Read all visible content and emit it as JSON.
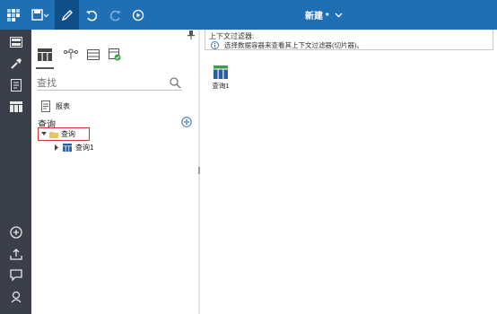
{
  "header": {
    "document_title": "新建 *",
    "colors": {
      "bar": "#1f6fb5",
      "active_tool": "#0f4e87"
    }
  },
  "rail": {
    "items": [
      "view-icon",
      "tools-icon",
      "document-icon",
      "table-icon",
      "add-icon",
      "upload-icon",
      "comment-icon",
      "user-icon"
    ]
  },
  "panel": {
    "tabs": [
      "data-grid-icon",
      "hierarchy-icon",
      "layout-icon",
      "checklist-icon"
    ],
    "search_placeholder": "查找",
    "report_label": "报表",
    "queries_label": "查询",
    "tree": {
      "folder_label": "查询",
      "query_label": "查询1"
    }
  },
  "canvas": {
    "context_filter_title": "上下文过滤器:",
    "context_filter_info": "选择数据容器来查看其上下文过滤器(切片器)。",
    "widget_label": "查询1"
  }
}
